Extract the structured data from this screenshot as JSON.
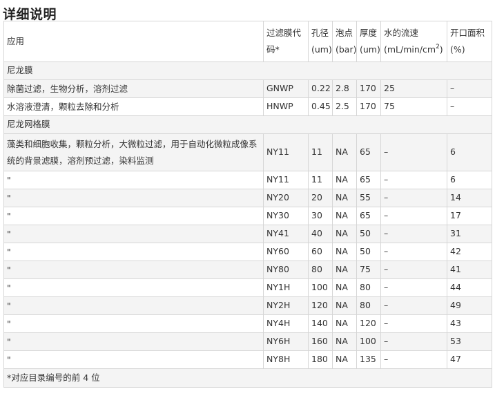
{
  "page": {
    "title": "详细说明"
  },
  "table": {
    "headers": {
      "application": "应用",
      "code": "过滤膜代码*",
      "pore": "孔径(um)",
      "bubble": "泡点(bar)",
      "thickness": "厚度(um)",
      "flow_main": "水的流速",
      "flow_unit_prefix": "(mL/min/cm",
      "flow_unit_sup": "2",
      "flow_unit_suffix": ")",
      "open_area": "开口面积(%)"
    },
    "sections": [
      {
        "label": "尼龙膜",
        "rows": [
          {
            "application": "除菌过滤，生物分析，溶剂过滤",
            "code": "GNWP",
            "pore": "0.22",
            "bubble": "2.8",
            "thickness": "170",
            "flow": "25",
            "open_area": "–"
          },
          {
            "application": "水溶液澄清，颗粒去除和分析",
            "code": "HNWP",
            "pore": "0.45",
            "bubble": "2.5",
            "thickness": "170",
            "flow": "75",
            "open_area": "–"
          }
        ]
      },
      {
        "label": "尼龙网格膜",
        "rows": [
          {
            "application": "藻类和细胞收集，颗粒分析，大微粒过滤，用于自动化微粒成像系统的背景滤膜，溶剂预过滤，染料监测",
            "code": "NY11",
            "pore": "11",
            "bubble": "NA",
            "thickness": "65",
            "flow": "–",
            "open_area": "6"
          },
          {
            "application": "\"",
            "code": "NY11",
            "pore": "11",
            "bubble": "NA",
            "thickness": "65",
            "flow": "–",
            "open_area": "6"
          },
          {
            "application": "\"",
            "code": "NY20",
            "pore": "20",
            "bubble": "NA",
            "thickness": "55",
            "flow": "–",
            "open_area": "14"
          },
          {
            "application": "\"",
            "code": "NY30",
            "pore": "30",
            "bubble": "NA",
            "thickness": "65",
            "flow": "–",
            "open_area": "17"
          },
          {
            "application": "\"",
            "code": "NY41",
            "pore": "40",
            "bubble": "NA",
            "thickness": "50",
            "flow": "–",
            "open_area": "31"
          },
          {
            "application": "\"",
            "code": "NY60",
            "pore": "60",
            "bubble": "NA",
            "thickness": "50",
            "flow": "–",
            "open_area": "42"
          },
          {
            "application": "\"",
            "code": "NY80",
            "pore": "80",
            "bubble": "NA",
            "thickness": "75",
            "flow": "–",
            "open_area": "41"
          },
          {
            "application": "\"",
            "code": "NY1H",
            "pore": "100",
            "bubble": "NA",
            "thickness": "80",
            "flow": "–",
            "open_area": "44"
          },
          {
            "application": "\"",
            "code": "NY2H",
            "pore": "120",
            "bubble": "NA",
            "thickness": "80",
            "flow": "–",
            "open_area": "49"
          },
          {
            "application": "\"",
            "code": "NY4H",
            "pore": "140",
            "bubble": "NA",
            "thickness": "120",
            "flow": "–",
            "open_area": "43"
          },
          {
            "application": "\"",
            "code": "NY6H",
            "pore": "160",
            "bubble": "NA",
            "thickness": "100",
            "flow": "–",
            "open_area": "53"
          },
          {
            "application": "\"",
            "code": "NY8H",
            "pore": "180",
            "bubble": "NA",
            "thickness": "135",
            "flow": "–",
            "open_area": "47"
          }
        ]
      }
    ],
    "footnote": "*对应目录编号的前 4 位"
  }
}
